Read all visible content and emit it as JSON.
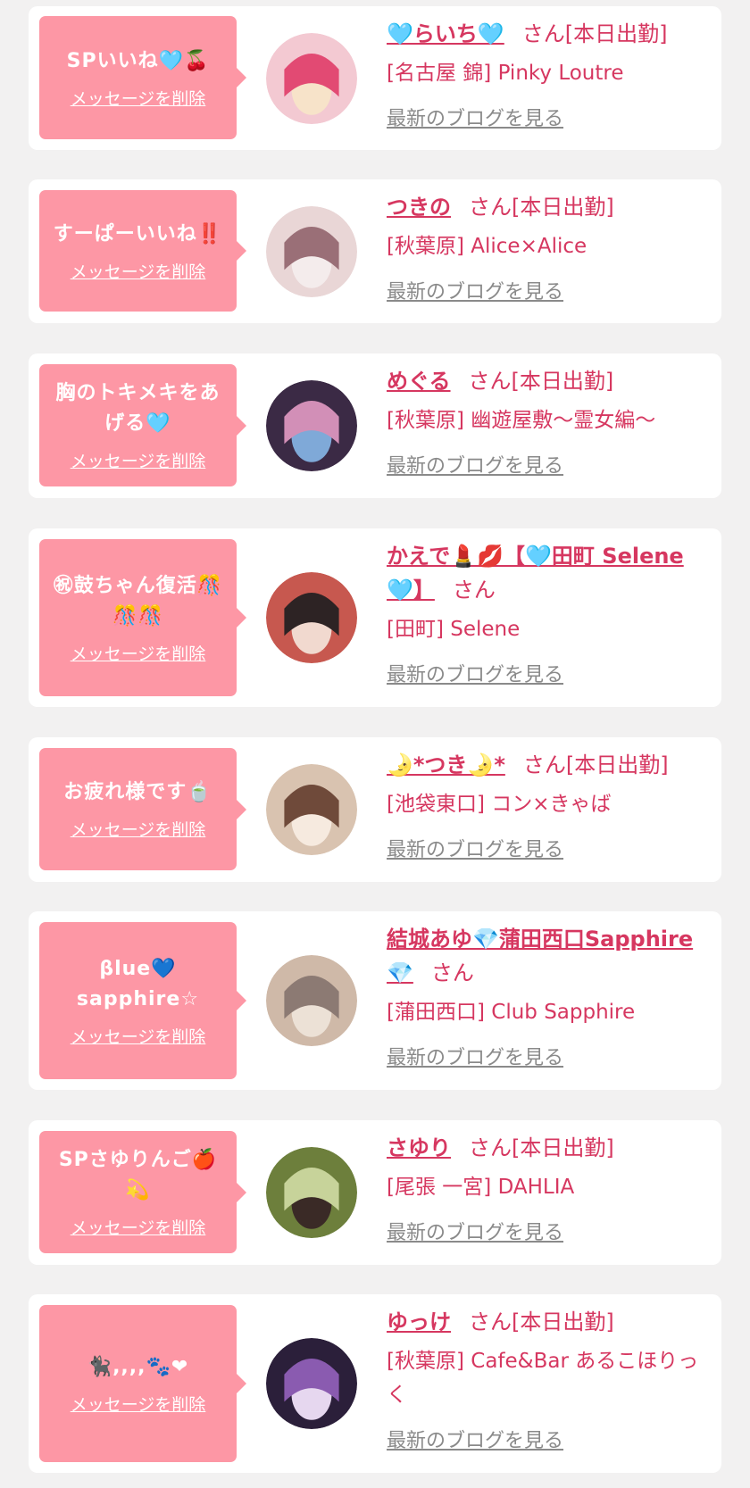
{
  "items": [
    {
      "message": "SPいいね🩵🍒",
      "delete_label": "メッセージを削除",
      "name": "🩵らいち🩵",
      "suffix": "さん[本日出勤]",
      "shop": "[名古屋 錦] Pinky Loutre",
      "blog_label": "最新のブログを見る",
      "avatar_colors": [
        "#f3c9d2",
        "#e24a73",
        "#f7e3c9"
      ]
    },
    {
      "message": "すーぱーいいね‼️",
      "delete_label": "メッセージを削除",
      "name": "つきの",
      "suffix": "さん[本日出勤]",
      "shop": "[秋葉原] Alice×Alice",
      "blog_label": "最新のブログを見る",
      "avatar_colors": [
        "#e9d6d6",
        "#9a6f77",
        "#f4ecec"
      ]
    },
    {
      "message": "胸のトキメキをあげる🩵",
      "delete_label": "メッセージを削除",
      "name": "めぐる",
      "suffix": "さん[本日出勤]",
      "shop": "[秋葉原] 幽遊屋敷〜霊女編〜",
      "blog_label": "最新のブログを見る",
      "avatar_colors": [
        "#3b2a45",
        "#d28fb7",
        "#7fa9d8"
      ]
    },
    {
      "message": "㊗鼓ちゃん復活🎊🎊🎊",
      "delete_label": "メッセージを削除",
      "name": "かえで💄💋【🩵田町 Selene🩵】",
      "suffix": "さん",
      "shop": "[田町] Selene",
      "blog_label": "最新のブログを見る",
      "avatar_colors": [
        "#c7584f",
        "#2d2324",
        "#f1d9cf"
      ]
    },
    {
      "message": "お疲れ様です🍵",
      "delete_label": "メッセージを削除",
      "name": "🌛*つき🌛*",
      "suffix": "さん[本日出勤]",
      "shop": "[池袋東口] コン×きゃば",
      "blog_label": "最新のブログを見る",
      "avatar_colors": [
        "#d9c3b0",
        "#6f4a3a",
        "#f6eadf"
      ]
    },
    {
      "message": "βlue💙sapphire☆",
      "delete_label": "メッセージを削除",
      "name": "結城あゆ💎蒲田西口Sapphire💎",
      "suffix": "さん",
      "shop": "[蒲田西口] Club Sapphire",
      "blog_label": "最新のブログを見る",
      "avatar_colors": [
        "#cfb9a8",
        "#8c7a73",
        "#ece1d6"
      ]
    },
    {
      "message": "SPさゆりんご🍎💫",
      "delete_label": "メッセージを削除",
      "name": "さゆり",
      "suffix": "さん[本日出勤]",
      "shop": "[尾張 一宮] DAHLIA",
      "blog_label": "最新のブログを見る",
      "avatar_colors": [
        "#6d7f3c",
        "#c7d39a",
        "#3a2a26"
      ]
    },
    {
      "message": "🐈‍⬛,,,,🐾❤",
      "delete_label": "メッセージを削除",
      "name": "ゆっけ",
      "suffix": "さん[本日出勤]",
      "shop": "[秋葉原] Cafe&Bar あるこほりっく",
      "blog_label": "最新のブログを見る",
      "avatar_colors": [
        "#2b1f3a",
        "#8a5bb0",
        "#e6d7ef"
      ]
    }
  ]
}
